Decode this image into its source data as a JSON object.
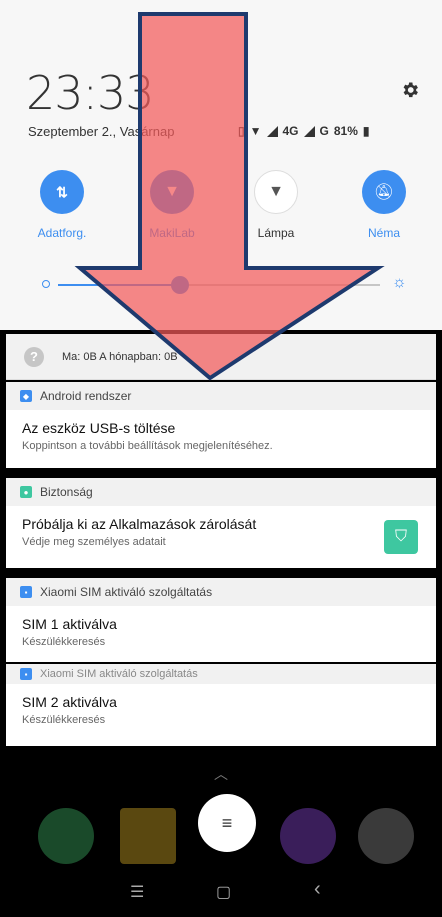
{
  "header": {
    "time": "23:33",
    "date": "Szeptember 2., Vasárnap",
    "network": "4G",
    "network2": "G",
    "battery": "81%"
  },
  "quick_settings": [
    {
      "label": "Adatforg.",
      "icon": "data-transfer-icon",
      "state": "on"
    },
    {
      "label": "MakiLab",
      "icon": "wifi-icon",
      "state": "on"
    },
    {
      "label": "Lámpa",
      "icon": "flashlight-icon",
      "state": "off"
    },
    {
      "label": "Néma",
      "icon": "bell-off-icon",
      "state": "on"
    }
  ],
  "brightness": {
    "value": 0.38
  },
  "data_usage": {
    "text": "Ma: 0B   A hónapban: 0B"
  },
  "notifications": [
    {
      "app": "Android rendszer",
      "title": "Az eszköz USB-s töltése",
      "subtitle": "Koppintson a további beállítások megjelenítéséhez.",
      "color": "#3d8ef0"
    },
    {
      "app": "Biztonság",
      "title": "Próbálja ki az Alkalmazások zárolását",
      "subtitle": "Védje meg személyes adatait",
      "color": "#3ec7a0"
    },
    {
      "app": "Xiaomi SIM aktiváló szolgáltatás",
      "title": "SIM 1 aktiválva",
      "subtitle": "Készülékkeresés",
      "color": "#3d8ef0"
    },
    {
      "app": "Xiaomi SIM aktiváló szolgáltatás",
      "title": "SIM 2 aktiválva",
      "subtitle": "Készülékkeresés",
      "color": "#3d8ef0"
    }
  ],
  "nav": {
    "menu": "☰",
    "home": "▢",
    "back": "‹"
  }
}
